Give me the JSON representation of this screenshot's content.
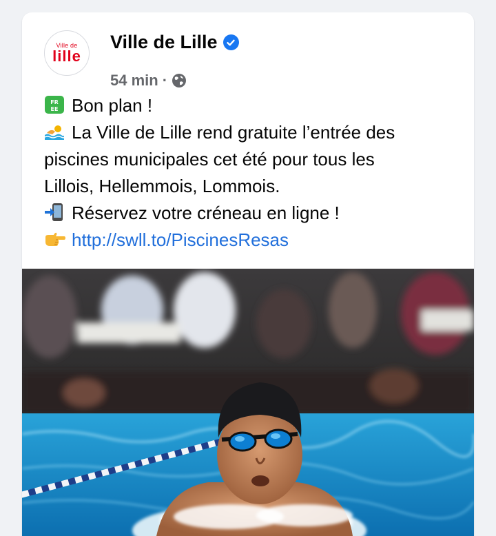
{
  "post": {
    "page_name": "Ville de Lille",
    "time": "54 min",
    "separator": "·",
    "logo": {
      "small": "Ville de",
      "big": "lille"
    },
    "lines": [
      "Bon plan !",
      "La Ville de Lille rend gratuite l’entrée des",
      "piscines municipales cet été pour tous les",
      "Lillois, Hellemmois, Lommois.",
      "Réservez votre créneau en ligne !",
      "http://swll.to/PiscinesResas"
    ],
    "emoji_free_text": "FREE",
    "icons": {
      "verified": "verified-check-icon",
      "audience": "globe-icon",
      "free": "free-button-emoji",
      "pool": "swimmer-emoji",
      "phone": "mobile-phone-arrow-emoji",
      "point": "pointing-right-emoji"
    },
    "colors": {
      "link": "#216fdb",
      "verified": "#1877f2",
      "brand_red": "#e1001a",
      "meta": "#65676b"
    }
  }
}
